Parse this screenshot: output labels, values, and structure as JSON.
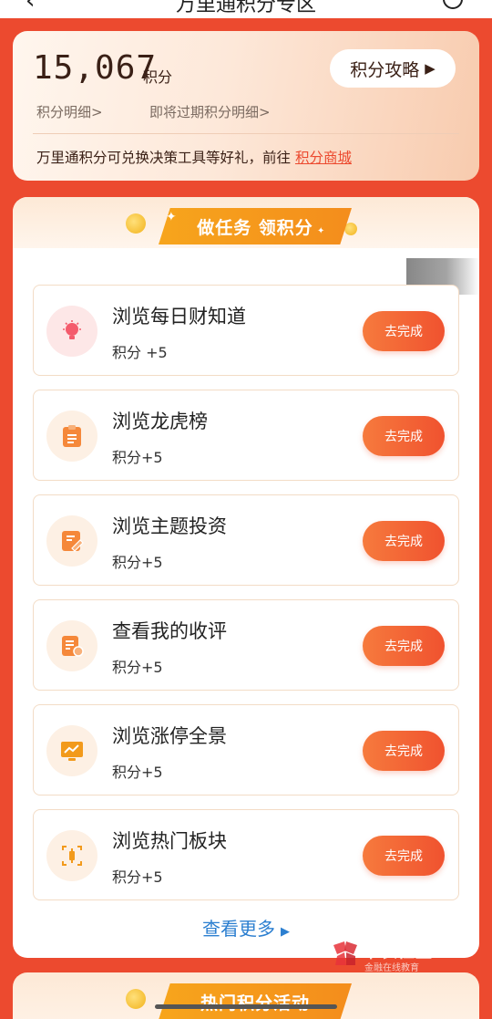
{
  "topbar": {
    "title": "万里通积分专区",
    "back_icon": "chevron-left-icon",
    "help_icon": "question-circle-icon"
  },
  "points": {
    "value": "15,067",
    "unit": "积分",
    "guide_label": "积分攻略",
    "detail_link": "积分明细>",
    "expiring_link": "即将过期积分明细>",
    "desc_prefix": "万里通积分可兑换决策工具等好礼，前往",
    "mall_link": "积分商城"
  },
  "tasks": {
    "header_title": "做任务 领积分",
    "items": [
      {
        "name": "浏览每日财知道",
        "points": "积分 +5",
        "button": "去完成",
        "icon": "lightbulb-icon",
        "icon_color": "#f45b6c"
      },
      {
        "name": "浏览龙虎榜",
        "points": "积分+5",
        "button": "去完成",
        "icon": "clipboard-icon",
        "icon_color": "#f5883a"
      },
      {
        "name": "浏览主题投资",
        "points": "积分+5",
        "button": "去完成",
        "icon": "edit-document-icon",
        "icon_color": "#f5883a"
      },
      {
        "name": "查看我的收评",
        "points": "积分+5",
        "button": "去完成",
        "icon": "report-icon",
        "icon_color": "#f5883a"
      },
      {
        "name": "浏览涨停全景",
        "points": "积分+5",
        "button": "去完成",
        "icon": "trend-monitor-icon",
        "icon_color": "#f29a1b"
      },
      {
        "name": "浏览热门板块",
        "points": "积分+5",
        "button": "去完成",
        "icon": "candlestick-icon",
        "icon_color": "#f29a1b"
      }
    ],
    "see_more": "查看更多"
  },
  "next_section": {
    "title": "热门积分活动"
  },
  "watermark": {
    "title": "卡农社区",
    "subtitle": "金融在线教育"
  },
  "colors": {
    "accent": "#ec4a2f",
    "button": "#f0522f",
    "link": "#2c7fd0",
    "ribbon": "#f7a51c"
  }
}
